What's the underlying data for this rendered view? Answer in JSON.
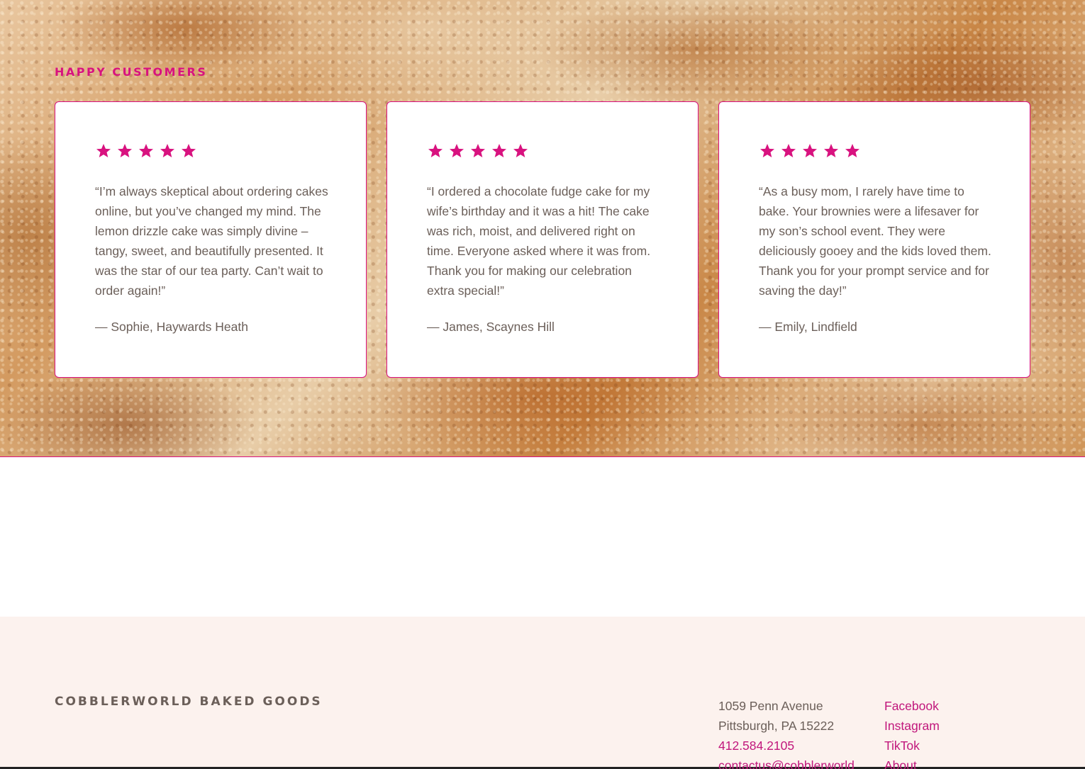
{
  "testimonials": {
    "heading": "HAPPY CUSTOMERS",
    "accent_color": "#d8127f",
    "rating_icon": "star-icon",
    "items": [
      {
        "stars": 5,
        "quote": "“I’m always skeptical about ordering cakes online, but you’ve changed my mind. The lemon drizzle cake was simply divine – tangy, sweet, and beautifully presented. It was the star of our tea party. Can’t wait to order again!”",
        "author": "— Sophie, Haywards Heath"
      },
      {
        "stars": 5,
        "quote": "“I ordered a chocolate fudge cake for my wife’s birthday and it was a hit! The cake was rich, moist, and delivered right on time. Everyone asked where it was from. Thank you for making our celebration extra special!”",
        "author": "— James, Scaynes Hill"
      },
      {
        "stars": 5,
        "quote": "“As a busy mom, I rarely have time to bake. Your brownies were a lifesaver for my son’s school event. They were deliciously gooey and the kids loved them. Thank you for your prompt service and for saving the day!”",
        "author": "— Emily, Lindfield"
      }
    ]
  },
  "footer": {
    "brand": "COBBLERWORLD BAKED GOODS",
    "address_line1": "1059 Penn Avenue",
    "address_line2": "Pittsburgh, PA 15222",
    "phone": "412.584.2105",
    "email": "contactus@cobblerworld",
    "links": [
      "Facebook",
      "Instagram",
      "TikTok",
      "About"
    ],
    "link_color": "#c1177c",
    "background": "#fcf2ee"
  }
}
